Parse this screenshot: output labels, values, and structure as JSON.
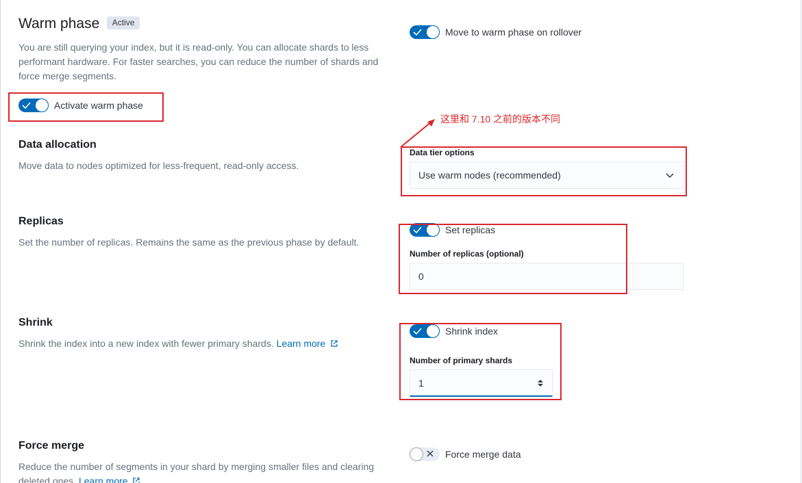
{
  "warm": {
    "title": "Warm phase",
    "badge": "Active",
    "description": "You are still querying your index, but it is read-only. You can allocate shards to less performant hardware. For faster searches, you can reduce the number of shards and force merge segments.",
    "activate_label": "Activate warm phase",
    "rollover_label": "Move to warm phase on rollover"
  },
  "annotation": {
    "text": "这里和 7.10 之前的版本不同",
    "color": "#d9272e"
  },
  "data_allocation": {
    "title": "Data allocation",
    "description": "Move data to nodes optimized for less-frequent, read-only access.",
    "field_label": "Data tier options",
    "selected": "Use warm nodes (recommended)"
  },
  "replicas": {
    "title": "Replicas",
    "description": "Set the number of replicas. Remains the same as the previous phase by default.",
    "switch_label": "Set replicas",
    "field_label": "Number of replicas (optional)",
    "value": "0"
  },
  "shrink": {
    "title": "Shrink",
    "description": "Shrink the index into a new index with fewer primary shards.",
    "learn_more": "Learn more",
    "switch_label": "Shrink index",
    "field_label": "Number of primary shards",
    "value": "1"
  },
  "force_merge": {
    "title": "Force merge",
    "description": "Reduce the number of segments in your shard by merging smaller files and clearing deleted ones.",
    "learn_more": "Learn more",
    "switch_label": "Force merge data"
  },
  "colors": {
    "accent": "#006bb8",
    "annotation_red": "#d9272e"
  }
}
